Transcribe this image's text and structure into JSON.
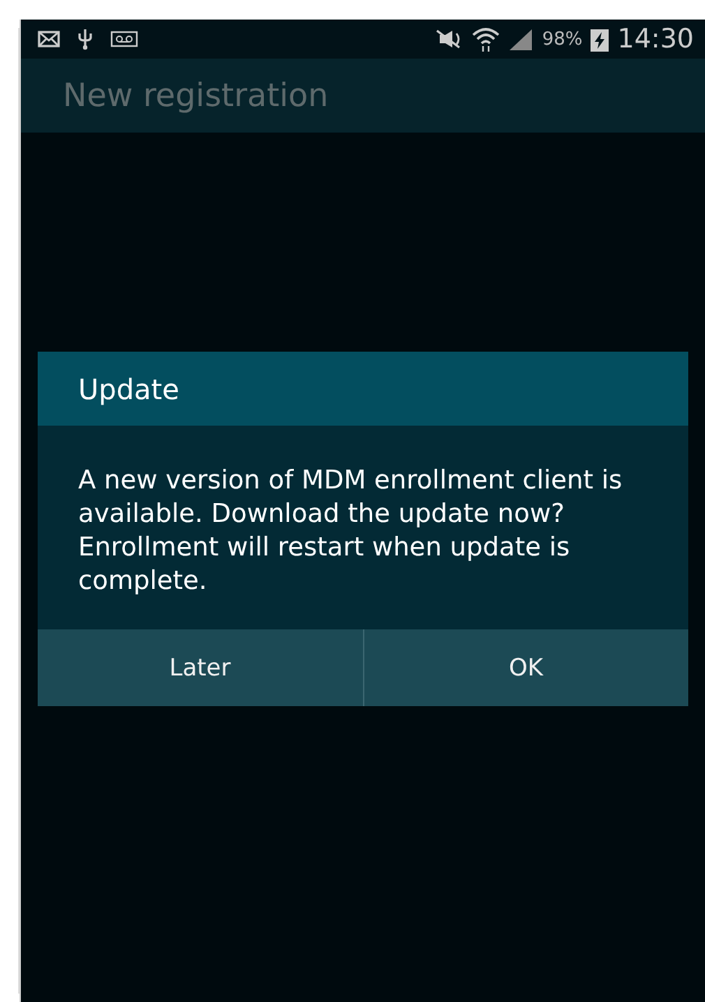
{
  "status_bar": {
    "battery_percent": "98%",
    "time": "14:30"
  },
  "app_bar": {
    "title": "New registration"
  },
  "dialog": {
    "title": "Update",
    "message": "A new version of MDM enrollment client is available. Download the update now? Enrollment will restart when update is complete.",
    "buttons": [
      {
        "label": "Later"
      },
      {
        "label": "OK"
      }
    ]
  }
}
